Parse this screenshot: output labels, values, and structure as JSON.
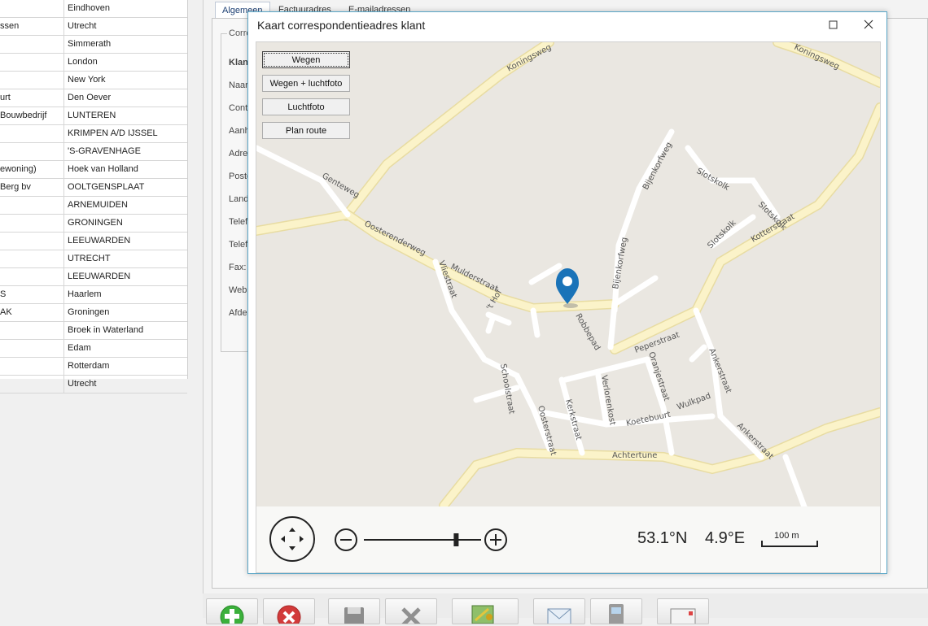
{
  "customers": [
    {
      "name": "",
      "city": "Eindhoven"
    },
    {
      "name": "ssen",
      "city": "Utrecht"
    },
    {
      "name": "",
      "city": "Simmerath"
    },
    {
      "name": "",
      "city": "London"
    },
    {
      "name": "",
      "city": "New York"
    },
    {
      "name": "urt",
      "city": "Den Oever"
    },
    {
      "name": "Bouwbedrijf",
      "city": "LUNTEREN"
    },
    {
      "name": "",
      "city": "KRIMPEN A/D IJSSEL"
    },
    {
      "name": "",
      "city": "'S-GRAVENHAGE"
    },
    {
      "name": "ewoning)",
      "city": "Hoek van Holland"
    },
    {
      "name": "Berg bv",
      "city": "OOLTGENSPLAAT"
    },
    {
      "name": "",
      "city": "ARNEMUIDEN"
    },
    {
      "name": "",
      "city": "GRONINGEN"
    },
    {
      "name": "",
      "city": "LEEUWARDEN"
    },
    {
      "name": "",
      "city": "UTRECHT"
    },
    {
      "name": "",
      "city": "LEEUWARDEN"
    },
    {
      "name": "S",
      "city": "Haarlem"
    },
    {
      "name": "AK",
      "city": "Groningen"
    },
    {
      "name": "",
      "city": "Broek in Waterland"
    },
    {
      "name": "",
      "city": "Edam"
    },
    {
      "name": "",
      "city": "Rotterdam"
    },
    {
      "name": "",
      "city": "Utrecht"
    }
  ],
  "tabs": {
    "general": "Algemeen",
    "invoice": "Factuuradres",
    "email": "E-mailadressen"
  },
  "form": {
    "legend": "Corre",
    "labels": [
      "Klan",
      "Naar",
      "Cont",
      "Aanh",
      "Adre",
      "Posto",
      "Land",
      "Telef",
      "Telef",
      "Fax:",
      "Web",
      "Afde"
    ]
  },
  "dialog": {
    "title": "Kaart correspondentieadres klant",
    "buttons": {
      "roads": "Wegen",
      "hybrid": "Wegen + luchtfoto",
      "aerial": "Luchtfoto",
      "route": "Plan route"
    }
  },
  "map": {
    "latitude": "53.1°N",
    "longitude": "4.9°E",
    "scale": "100 m",
    "zoom_level": 0.8,
    "street_labels": [
      "Koningsweg",
      "Koningsweg",
      "Genteweg",
      "Oosterenderweg",
      "Mulderstraat",
      "Vliestraat",
      "Bijenkorfweg",
      "Bijenkorfweg",
      "Slotskolk",
      "Slotskolk",
      "Slotskolk",
      "Kotterstraat",
      "'t Hof",
      "Robbepad",
      "Peperstraat",
      "Oranjestraat",
      "Ankerstraat",
      "Ankerstraat",
      "Schoolstraat",
      "Verlorenkost",
      "Kerkstraat",
      "Oosterstraat",
      "Koetebuurt",
      "Wulkpad",
      "Achtertune"
    ]
  },
  "icons": {
    "marker": "map-pin-icon",
    "nav": "pan-navigation-icon",
    "zoom_in": "zoom-in-icon",
    "zoom_out": "zoom-out-icon"
  },
  "colors": {
    "road": "#fbf3c9",
    "road_edge": "#e8dca2",
    "minor_road": "#ffffff",
    "land": "#eae7e1",
    "marker": "#1a73b8",
    "accent_border": "#5aa6c7"
  }
}
